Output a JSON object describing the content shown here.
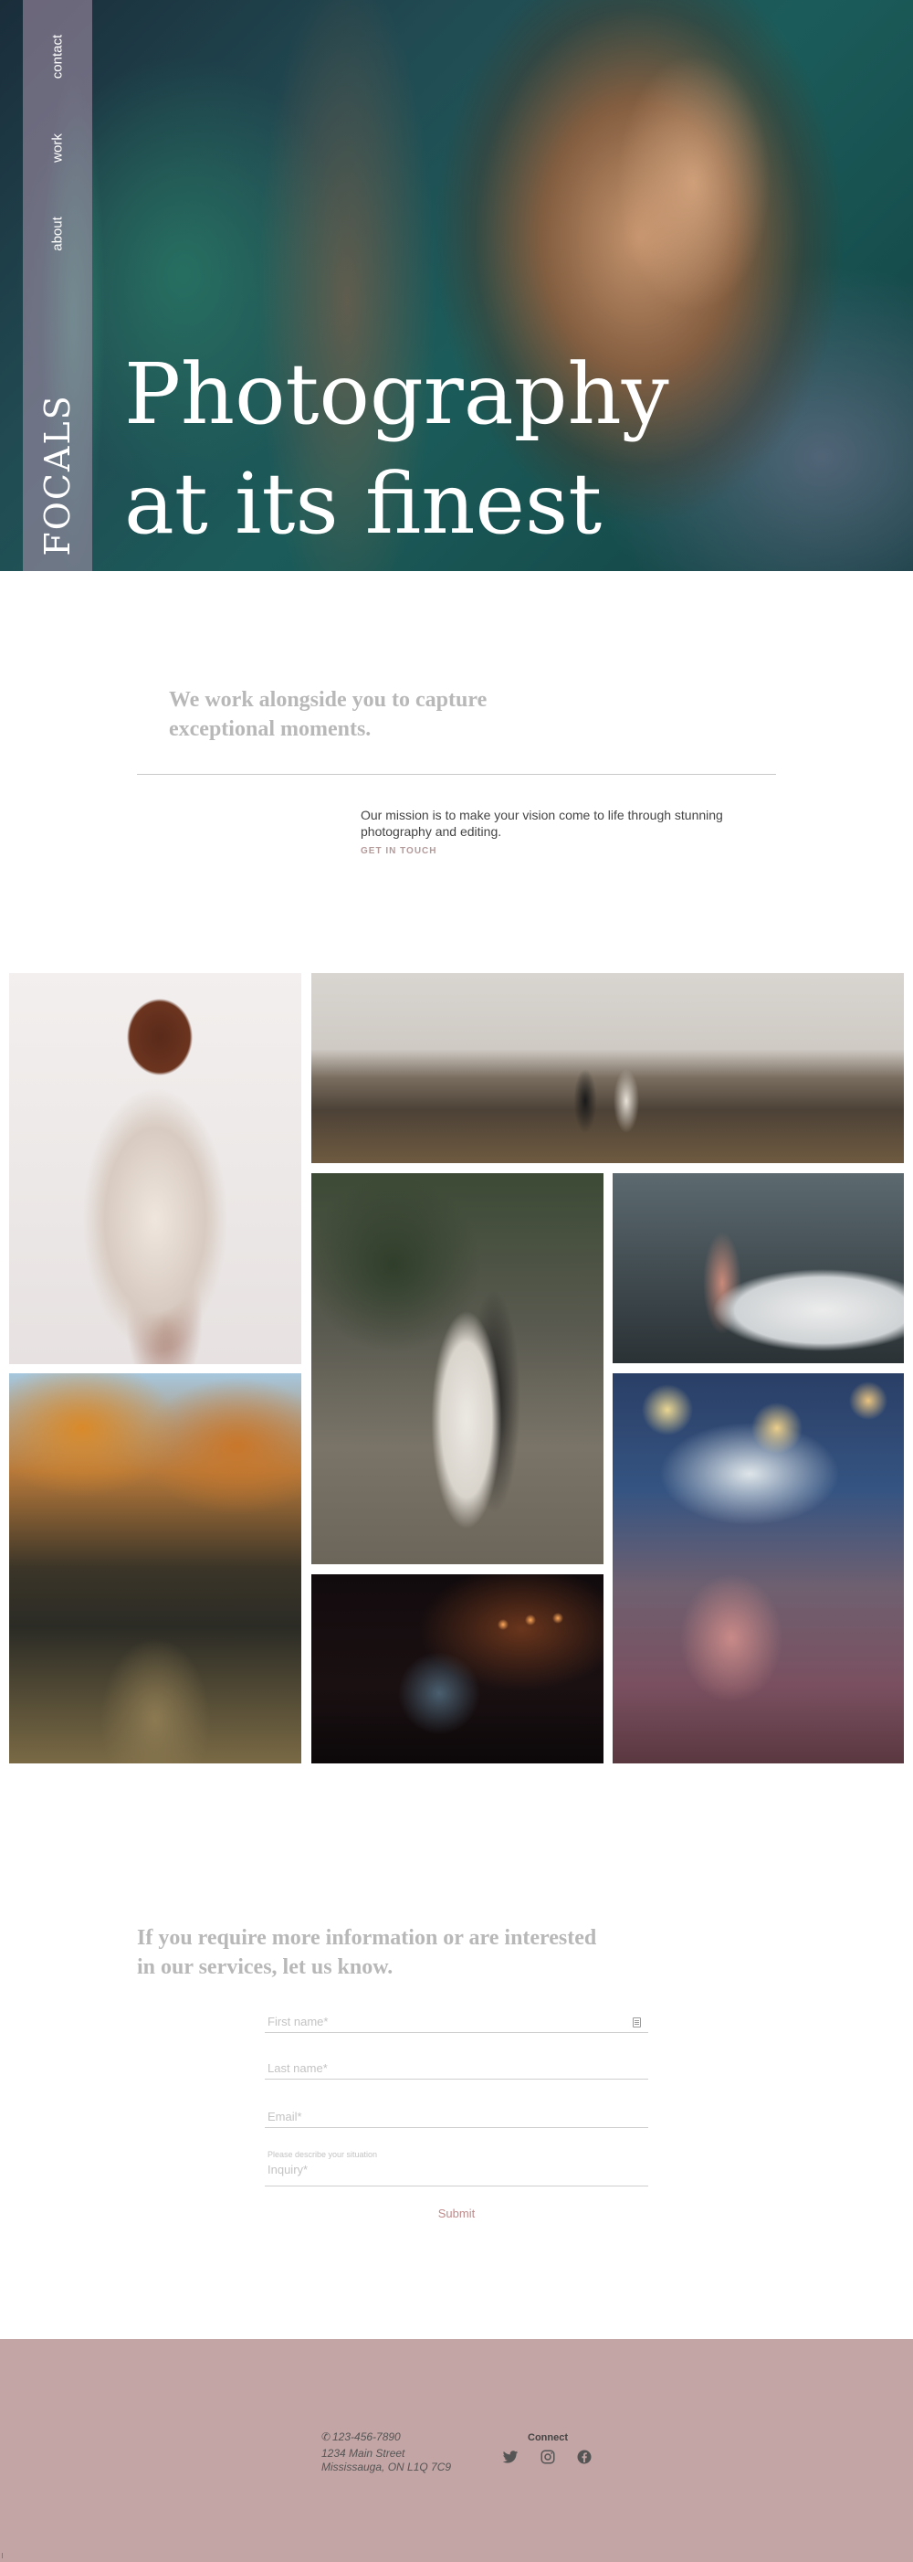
{
  "hero": {
    "nav": [
      {
        "label": "contact"
      },
      {
        "label": "work"
      },
      {
        "label": "about"
      }
    ],
    "logo": "FOCALS",
    "title_line1": "Photography",
    "title_line2": "at its finest"
  },
  "intro": {
    "heading_line1": "We work alongside you to capture",
    "heading_line2": "exceptional moments.",
    "mission": "Our mission is to make your vision come to life through stunning photography and editing.",
    "cta": "GET IN TOUCH"
  },
  "contact": {
    "heading_line1": "If you require more information or are interested",
    "heading_line2": "in our services, let us know.",
    "first_name_placeholder": "First name*",
    "last_name_placeholder": "Last name*",
    "email_placeholder": "Email*",
    "inquiry_hint": "Please describe your situation",
    "inquiry_placeholder": "Inquiry*",
    "submit_label": "Submit"
  },
  "footer": {
    "phone": "123-456-7890",
    "address_line1": "1234 Main Street",
    "address_line2": "Mississauga, ON L1Q 7C9",
    "connect_label": "Connect",
    "social": [
      "twitter-icon",
      "instagram-icon",
      "facebook-icon"
    ]
  },
  "colors": {
    "sidebar": "#af96af",
    "footer_bg": "#c3a5a5",
    "accent": "#c08a8a",
    "heading_gray": "#b8b8b8"
  }
}
